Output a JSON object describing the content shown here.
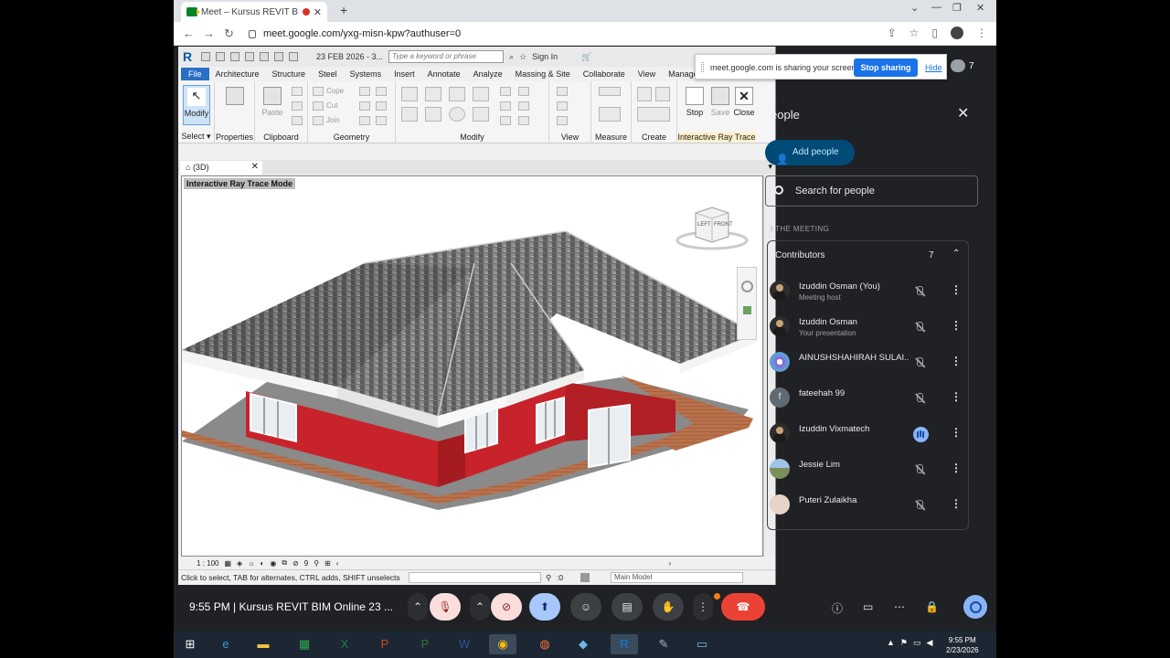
{
  "browser": {
    "tab_title": "Meet – Kursus REVIT BIM Onl",
    "url": "meet.google.com/yxg-misn-kpw?authuser=0"
  },
  "revit": {
    "date_label": "23 FEB 2026 - 3...",
    "search_placeholder": "Type a keyword or phrase",
    "sign_in": "Sign In",
    "tabs": [
      "File",
      "Architecture",
      "Structure",
      "Steel",
      "Systems",
      "Insert",
      "Annotate",
      "Analyze",
      "Massing & Site",
      "Collaborate",
      "View",
      "Manage",
      "Ac"
    ],
    "ribbon": {
      "modify": "Modify",
      "paste": "Paste",
      "cope": "Cope",
      "cut": "Cut",
      "join": "Join",
      "stop": "Stop",
      "save": "Save",
      "close": "Close",
      "panels": [
        "Select",
        "Properties",
        "Clipboard",
        "Geometry",
        "Modify",
        "View",
        "Measure",
        "Create",
        "Interactive Ray Trace"
      ]
    },
    "view_tab": "(3D)",
    "mode_label": "Interactive Ray Trace Mode",
    "viewcube": {
      "front": "FRONT",
      "left": "LEFT"
    },
    "scale": "1 : 100",
    "crop_num": "9",
    "status_text": "Click to select, TAB for alternates, CTRL adds, SHIFT unselects",
    "sel_count": ":0",
    "model_dropdown": "Main Model"
  },
  "share_banner": {
    "message": "meet.google.com is sharing your screen.",
    "stop_label": "Stop sharing",
    "hide_label": "Hide"
  },
  "participant_count": "7",
  "people_panel": {
    "title": "eople",
    "add_people": "Add people",
    "search_placeholder": "Search for people",
    "section": "I THE MEETING",
    "group_label": "Contributors",
    "group_count": "7",
    "people": [
      {
        "name": "Izuddin Osman (You)",
        "sub": "Meeting host",
        "avatar": "photo",
        "mic": "muted"
      },
      {
        "name": "Izuddin Osman",
        "sub": "Your presentation",
        "avatar": "photo",
        "mic": "muted"
      },
      {
        "name": "AINUSHSHAHIRAH SULAI...",
        "sub": "",
        "avatar": "flower",
        "mic": "muted"
      },
      {
        "name": "fateehah 99",
        "sub": "",
        "avatar": "letter",
        "letter": "f",
        "mic": "muted"
      },
      {
        "name": "Izuddin Vixmatech",
        "sub": "",
        "avatar": "photo",
        "mic": "speaking"
      },
      {
        "name": "Jessie Lim",
        "sub": "",
        "avatar": "landscape",
        "mic": "muted"
      },
      {
        "name": "Puteri Zulaikha",
        "sub": "",
        "avatar": "girl",
        "mic": "muted"
      }
    ]
  },
  "meet_bar": {
    "time_title": "9:55 PM  |  Kursus REVIT BIM Online 23 ..."
  },
  "taskbar": {
    "time": "9:55 PM",
    "date": "2/23/2026"
  },
  "colors": {
    "meet_bg": "#202124",
    "accent_blue": "#1a73e8",
    "end_call": "#ea4335",
    "revit_file_tab": "#2a6fc6",
    "wall_red": "#c8232a"
  }
}
